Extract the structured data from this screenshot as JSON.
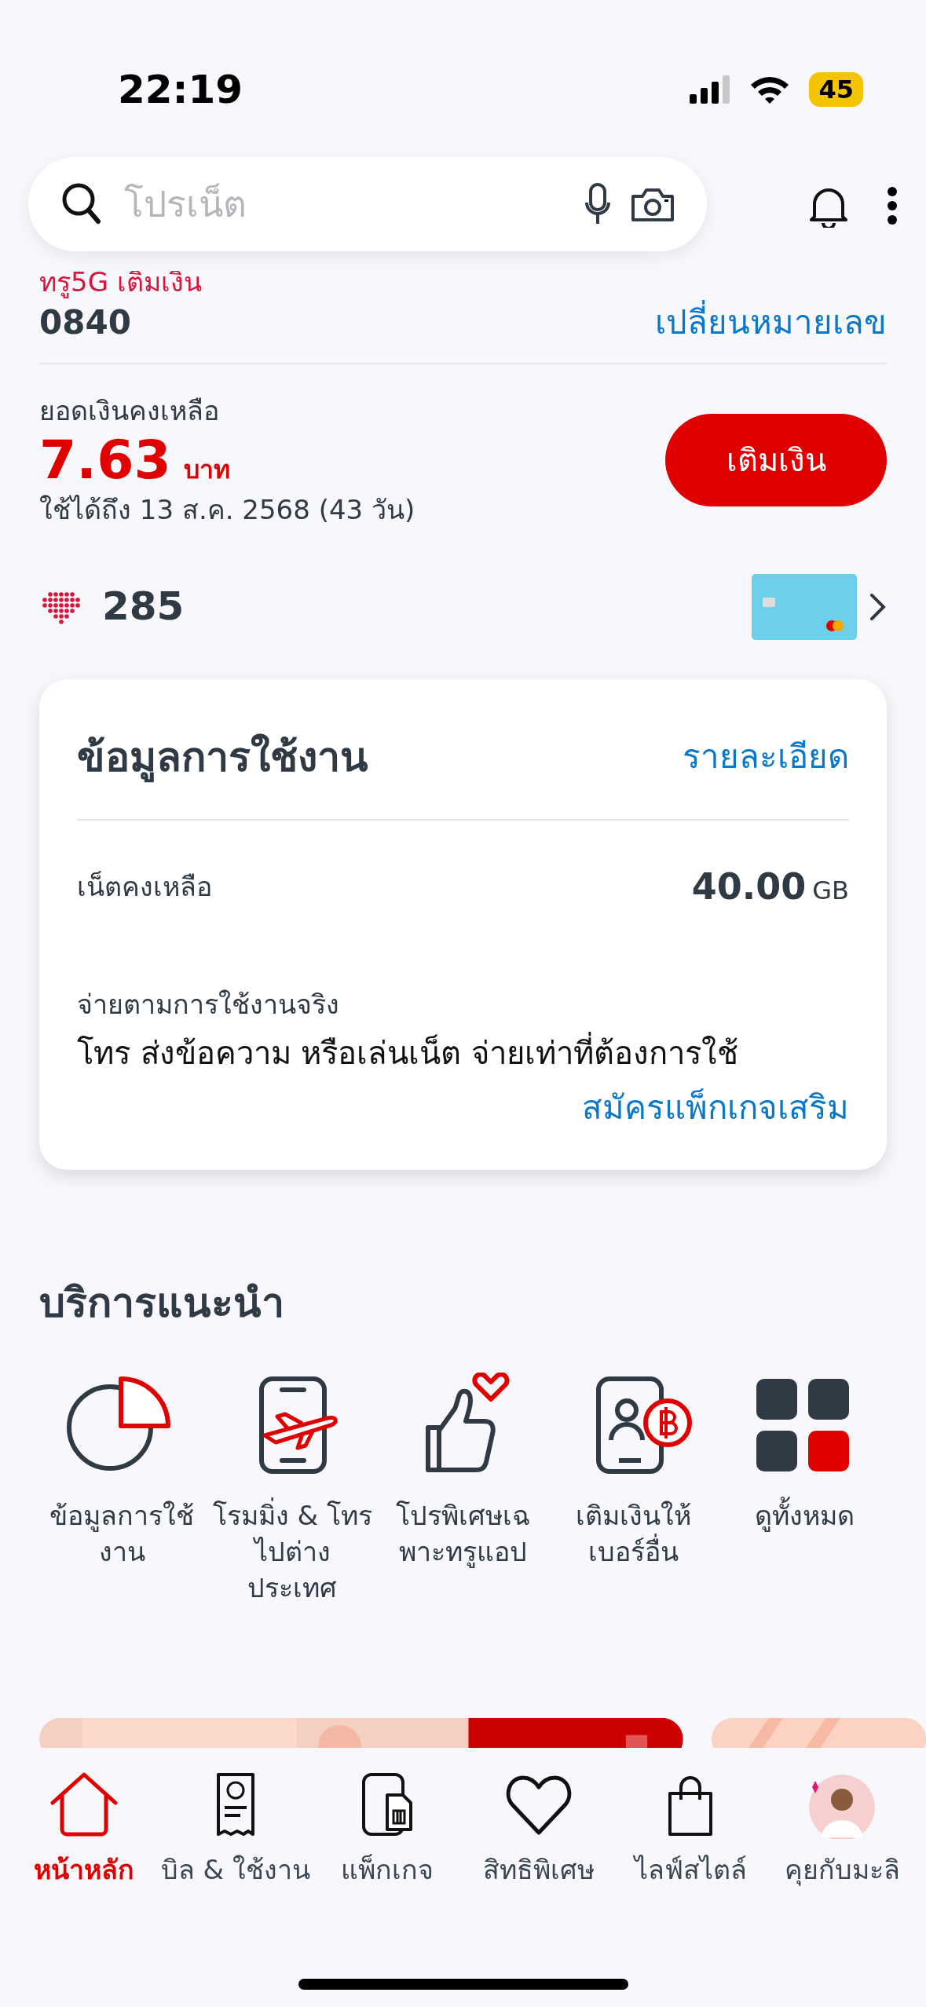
{
  "status_bar": {
    "time": "22:19",
    "battery": "45"
  },
  "search": {
    "placeholder": "โปรเน็ต"
  },
  "account": {
    "label": "ทรู5G เติมเงิน",
    "number": "0840",
    "change_link": "เปลี่ยนหมายเลข"
  },
  "balance": {
    "label": "ยอดเงินคงเหลือ",
    "amount": "7.63",
    "unit": "บาท",
    "validity": "ใช้ได้ถึง 13 ส.ค. 2568 (43 วัน)",
    "topup_button": "เติมเงิน"
  },
  "points": {
    "value": "285"
  },
  "usage_card": {
    "title": "ข้อมูลการใช้งาน",
    "detail_link": "รายละเอียด",
    "rows": [
      {
        "label": "เน็ตคงเหลือ",
        "value": "40.00",
        "unit": "GB"
      }
    ],
    "payg": {
      "title": "จ่ายตามการใช้งานจริง",
      "description": "โทร ส่งข้อความ หรือเล่นเน็ต จ่ายเท่าที่ต้องการใช้",
      "link": "สมัครแพ็กเกจเสริม"
    }
  },
  "services": {
    "title": "บริการแนะนำ",
    "items": [
      {
        "kind": "usage",
        "label": "ข้อมูลการใช้งาน"
      },
      {
        "kind": "roaming",
        "label": "โรมมิ่ง & โทรไปต่างประเทศ"
      },
      {
        "kind": "promo",
        "label": "โปรพิเศษเฉพาะทรูแอป"
      },
      {
        "kind": "topup",
        "label": "เติมเงินให้เบอร์อื่น"
      },
      {
        "kind": "all",
        "label": "ดูทั้งหมด"
      }
    ]
  },
  "bottom_nav": {
    "items": [
      {
        "kind": "home",
        "label": "หน้าหลัก",
        "selected": true
      },
      {
        "kind": "bill",
        "label": "บิล & ใช้งาน",
        "selected": false
      },
      {
        "kind": "package",
        "label": "แพ็กเกจ",
        "selected": false
      },
      {
        "kind": "privilege",
        "label": "สิทธิพิเศษ",
        "selected": false
      },
      {
        "kind": "lifestyle",
        "label": "ไลฟ์สไตล์",
        "selected": false
      },
      {
        "kind": "chat",
        "label": "คุยกับมะลิ",
        "selected": false
      }
    ]
  }
}
